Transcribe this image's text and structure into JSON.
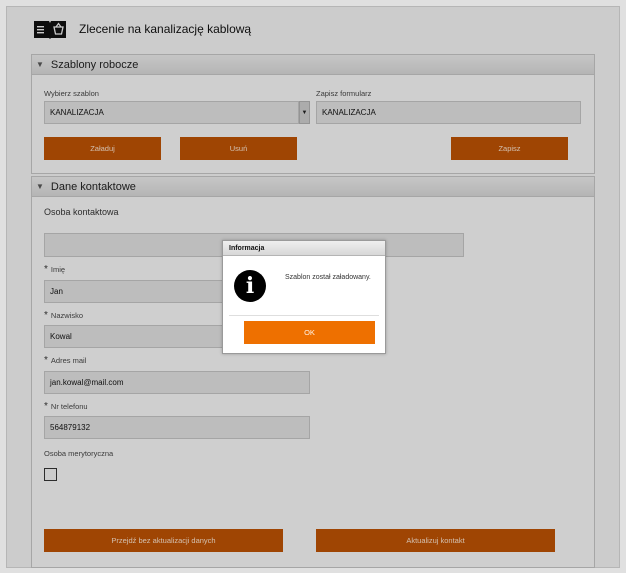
{
  "header": {
    "title": "Zlecenie na kanalizację kablową",
    "logo_icon": "book-basket-icon"
  },
  "templates_panel": {
    "title": "Szablony robocze",
    "select_label": "Wybierz szablon",
    "select_value": "KANALIZACJA",
    "save_label": "Zapisz formularz",
    "save_value": "KANALIZACJA",
    "load_button": "Załaduj",
    "delete_button": "Usuń",
    "save_button": "Zapisz"
  },
  "contact_panel": {
    "title": "Dane kontaktowe",
    "contact_person_label": "Osoba kontaktowa",
    "contact_person_value": "",
    "first_name_label": "Imię",
    "first_name_value": "Jan",
    "last_name_label": "Nazwisko",
    "last_name_value": "Kowal",
    "email_label": "Adres mail",
    "email_value": "jan.kowal@mail.com",
    "phone_label": "Nr telefonu",
    "phone_value": "564879132",
    "substantive_label": "Osoba merytoryczna",
    "skip_button": "Przejdź bez aktualizacji danych",
    "update_button": "Aktualizuj kontakt"
  },
  "dialog": {
    "title": "Informacja",
    "message": "Szablon został załadowany.",
    "ok_button": "OK",
    "icon": "info-icon"
  },
  "colors": {
    "button": "#b54f04",
    "dialog_button": "#ee7000"
  }
}
